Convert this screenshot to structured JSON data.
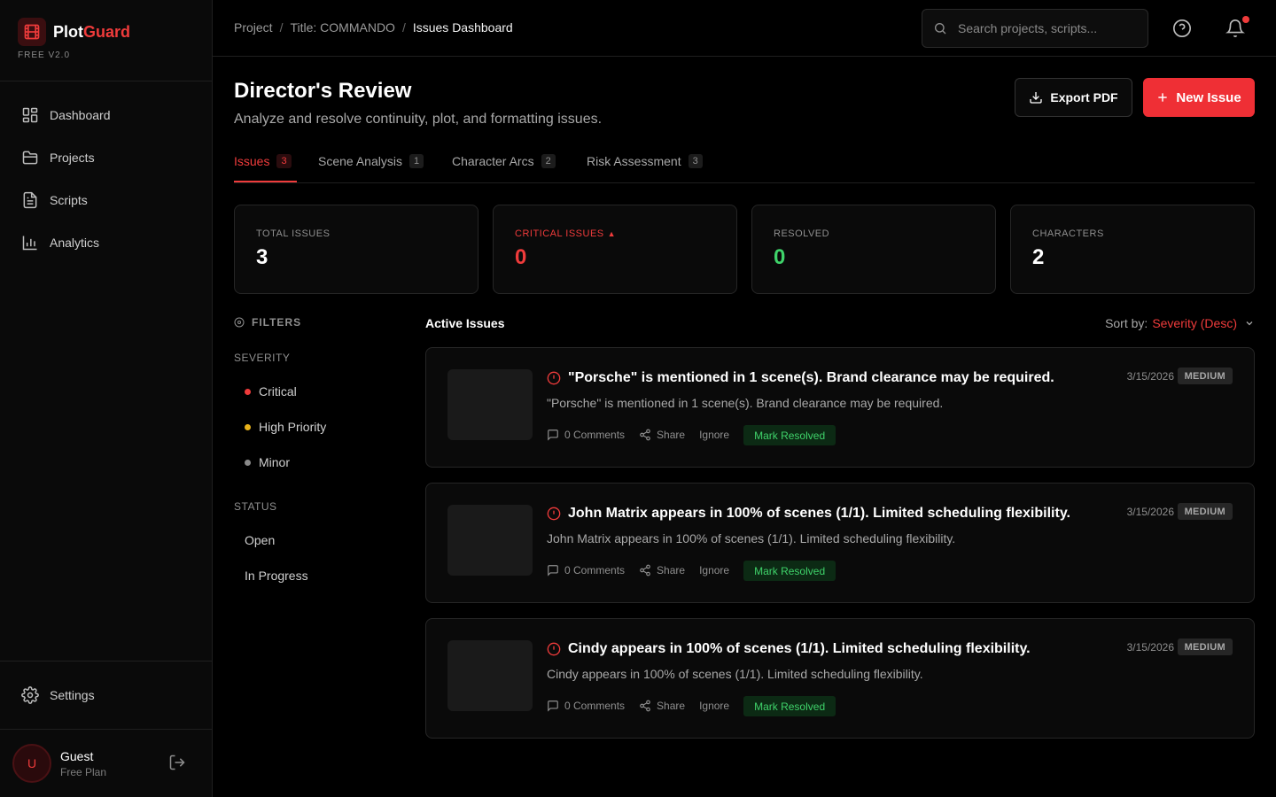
{
  "app": {
    "name_plain": "Plot",
    "name_accent": "Guard",
    "version": "FREE V2.0",
    "accent_color": "#ef3b3b"
  },
  "sidebar": {
    "items": [
      {
        "label": "Dashboard",
        "icon": "dashboard-icon"
      },
      {
        "label": "Projects",
        "icon": "folder-icon"
      },
      {
        "label": "Scripts",
        "icon": "document-icon"
      },
      {
        "label": "Analytics",
        "icon": "bar-chart-icon"
      }
    ],
    "settings_label": "Settings",
    "user": {
      "initial": "U",
      "name": "Guest",
      "plan": "Free Plan"
    }
  },
  "topbar": {
    "breadcrumb": [
      "Project",
      "Title: COMMANDO",
      "Issues Dashboard"
    ],
    "search_placeholder": "Search projects, scripts..."
  },
  "header": {
    "title": "Director's Review",
    "subtitle": "Analyze and resolve continuity, plot, and formatting issues.",
    "export_label": "Export PDF",
    "new_issue_label": "New Issue"
  },
  "tabs": [
    {
      "label": "Issues",
      "count": "3",
      "active": true
    },
    {
      "label": "Scene Analysis",
      "count": "1"
    },
    {
      "label": "Character Arcs",
      "count": "2"
    },
    {
      "label": "Risk Assessment",
      "count": "3"
    }
  ],
  "stats": [
    {
      "label": "TOTAL ISSUES",
      "value": "3",
      "color": "#ffffff"
    },
    {
      "label": "CRITICAL ISSUES",
      "value": "0",
      "color": "#ef3b3b"
    },
    {
      "label": "RESOLVED",
      "value": "0",
      "color": "#3fd36a"
    },
    {
      "label": "CHARACTERS",
      "value": "2",
      "color": "#ffffff"
    }
  ],
  "filters": {
    "heading": "FILTERS",
    "severity_label": "SEVERITY",
    "severity": [
      {
        "label": "Critical",
        "color": "#ef3b3b"
      },
      {
        "label": "High Priority",
        "color": "#e8b21a"
      },
      {
        "label": "Minor",
        "color": "#8a8a8a"
      }
    ],
    "status_label": "STATUS",
    "status": [
      "Open",
      "In Progress"
    ]
  },
  "issues_list": {
    "heading": "Active Issues",
    "sort_label": "Sort by:",
    "sort_value": "Severity (Desc)",
    "items": [
      {
        "title": "\"Porsche\" is mentioned in 1 scene(s). Brand clearance may be required.",
        "description": "\"Porsche\" is mentioned in 1 scene(s). Brand clearance may be required.",
        "date": "3/15/2026",
        "severity": "MEDIUM",
        "comments": "0 Comments",
        "share": "Share",
        "ignore": "Ignore",
        "resolve": "Mark Resolved"
      },
      {
        "title": "John Matrix appears in 100% of scenes (1/1). Limited scheduling flexibility.",
        "description": "John Matrix appears in 100% of scenes (1/1). Limited scheduling flexibility.",
        "date": "3/15/2026",
        "severity": "MEDIUM",
        "comments": "0 Comments",
        "share": "Share",
        "ignore": "Ignore",
        "resolve": "Mark Resolved"
      },
      {
        "title": "Cindy appears in 100% of scenes (1/1). Limited scheduling flexibility.",
        "description": "Cindy appears in 100% of scenes (1/1). Limited scheduling flexibility.",
        "date": "3/15/2026",
        "severity": "MEDIUM",
        "comments": "0 Comments",
        "share": "Share",
        "ignore": "Ignore",
        "resolve": "Mark Resolved"
      }
    ]
  }
}
